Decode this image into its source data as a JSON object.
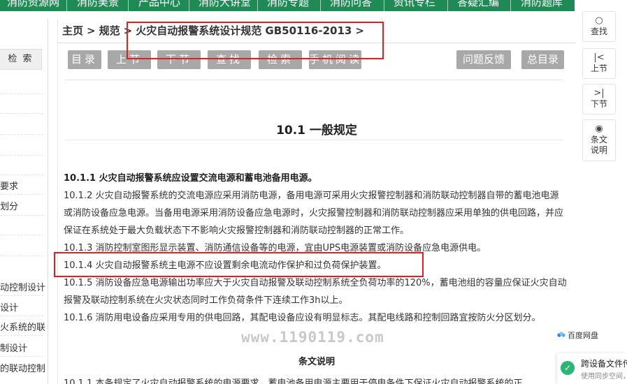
{
  "topnav": {
    "items": [
      "消防资源网",
      "消防美景",
      "产品中心",
      "消防大讲堂",
      "消防专题",
      "消防问答",
      "资讯专栏",
      "答疑汇编",
      "消防题库"
    ]
  },
  "sidebar": {
    "search_label": "检 索",
    "items": [
      "要求",
      "划分",
      "动控制设计",
      "设计",
      "火系统的联",
      "制设计",
      "的联动控制"
    ]
  },
  "breadcrumb": {
    "home": "主页",
    "sep": ">",
    "spec": "规范",
    "doc": "火灾自动报警系统设计规范 GB50116-2013"
  },
  "toolbar": {
    "catalog": "目录",
    "prev": "上节",
    "next": "下节",
    "find": "查找",
    "search": "检索",
    "mobile": "手机阅读",
    "feedback": "问题反馈",
    "master": "总目录"
  },
  "content": {
    "section_title": "10.1 一般规定",
    "p1": "10.1.1 火灾自动报警系统应设置交流电源和蓄电池备用电源。",
    "p2": "10.1.2 火灾自动报警系统的交流电源应采用消防电源，备用电源可采用火灾报警控制器和消防联动控制器自带的蓄电池电源或消防设备应急电源。当备用电源采用消防设备应急电源时，火灾报警控制器和消防联动控制器应采用单独的供电回路，并应保证在系统处于最大负载状态下不影响火灾报警控制器和消防联动控制器的正常工作。",
    "p3": "10.1.3 消防控制室图形显示装置、消防通信设备等的电源，宜由UPS电源装置或消防设备应急电源供电。",
    "p4": "10.1.4 火灾自动报警系统主电源不应设置剩余电流动作保护和过负荷保护装置。",
    "p5": "10.1.5 消防设备应急电源输出功率应大于火灾自动报警及联动控制系统全负荷功率的120%，蓄电池组的容量应保证火灾自动报警及联动控制系统在火灾状态同时工作负荷条件下连续工作3h以上。",
    "p6": "10.1.6 消防用电设备应采用专用的供电回路，其配电设备应设有明显标志。其配电线路和控制回路宜按防火分区划分。",
    "subtitle": "条文说明",
    "p7": "10.1.1 本条规定了火灾自动报警系统的电源要求，蓄电池备用电源主要用于停电条件下保证火灾自动报警系统的正",
    "watermark": "www.1190119.com"
  },
  "right_toolbar": {
    "find": "查找",
    "prev": "上节",
    "next": "下节",
    "explain": "条文说明"
  },
  "popups": {
    "pan_name": "百度网盘",
    "sync_title": "跨设备文件传",
    "sync_sub": "使用同步空间，"
  },
  "colors": {
    "nav_green": "#1f8a56",
    "button_gray": "#a8a8a8",
    "highlight_red": "#e02020",
    "check_green": "#2bb673"
  }
}
